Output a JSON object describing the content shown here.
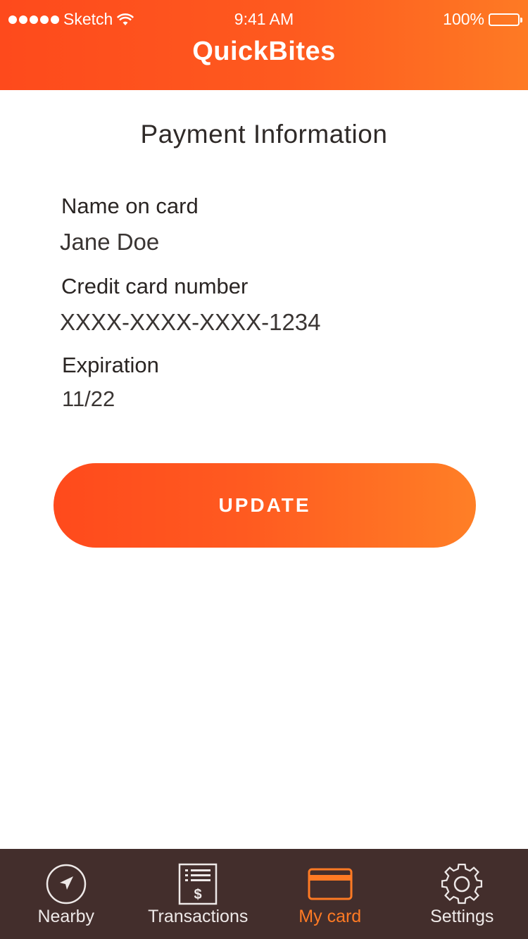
{
  "status_bar": {
    "carrier": "Sketch",
    "time": "9:41 AM",
    "battery": "100%"
  },
  "header": {
    "title": "QuickBites"
  },
  "main": {
    "title": "Payment Information",
    "fields": [
      {
        "label": "Name on card",
        "value": "Jane Doe"
      },
      {
        "label": "Credit card number",
        "value": "XXXX-XXXX-XXXX-1234"
      },
      {
        "label": "Expiration",
        "value": "11/22"
      }
    ],
    "update_label": "UPDATE"
  },
  "tabbar": {
    "tabs": [
      {
        "label": "Nearby",
        "icon": "location-arrow-icon"
      },
      {
        "label": "Transactions",
        "icon": "receipt-icon"
      },
      {
        "label": "My card",
        "icon": "credit-card-icon",
        "active": true
      },
      {
        "label": "Settings",
        "icon": "gear-icon"
      }
    ]
  },
  "colors": {
    "accent": "#ff5a20",
    "accent_end": "#ff7f26",
    "tabbar_bg": "#432e2c",
    "active_tab": "#ff7a24"
  }
}
